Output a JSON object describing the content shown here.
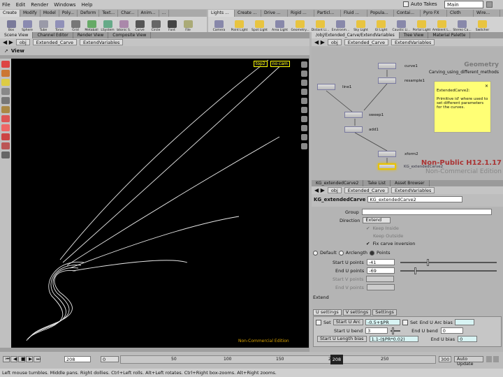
{
  "menubar": {
    "items": [
      "File",
      "Edit",
      "Render",
      "Windows",
      "Help"
    ],
    "autotakes_label": "Auto Takes",
    "take_value": "Main"
  },
  "shelf": {
    "tabs_left": [
      "Create",
      "Modify",
      "Model",
      "Poly...",
      "Deform",
      "Text...",
      "Char...",
      "Anim...",
      "..."
    ],
    "tabs_right": [
      "Lights ...",
      "Create ...",
      "Drive ...",
      "Rigid ...",
      "Particl...",
      "Fluid ...",
      "Popula...",
      "Contai...",
      "Pyro FX",
      "Cloth",
      "Wire..."
    ],
    "tools_left": [
      "Box",
      "Sphere",
      "Tube",
      "Torus",
      "Grid",
      "Metaball",
      "LSystem",
      "Platonic S...",
      "Curve",
      "Circle",
      "Font",
      "File"
    ],
    "tools_right": [
      "Camera",
      "Point Light",
      "Spot Light",
      "Area Light",
      "Geometry...",
      "Distant Li...",
      "Environm...",
      "Sky Light",
      "GI Light",
      "Caustic Li...",
      "Portal Light",
      "Ambient L...",
      "Stereo Ca...",
      "Switcher"
    ]
  },
  "left_pane": {
    "tabs": [
      "Scene View",
      "Channel Editor",
      "Render View",
      "Composite View"
    ],
    "path_obj": "obj",
    "path_node": "Extended_Carve",
    "path_sub": "ExtendVariables",
    "view_title": "View",
    "cam_top": "top2",
    "cam_nocam": "no cam",
    "watermark": "Non-Commercial Edition"
  },
  "network": {
    "tabs": [
      "/obj/Extended_Carve/ExtendVariables",
      "Tree View",
      "Material Palette"
    ],
    "path_obj": "obj",
    "path_node": "Extended_Carve",
    "path_sub": "ExtendVariables",
    "geometry_label": "Geometry",
    "context_label": "Carving_using_different_methods",
    "nodes": [
      "curve1",
      "resample1",
      "line1",
      "sweep1",
      "add1",
      "xform2",
      "KG_extendedCarve2"
    ],
    "note_title": "ExtendedCarve2:",
    "note_body": "Primitive id' where used to set different parameters for the curves.",
    "version": "Non-Public H12.1.17",
    "edition": "Non-Commercial Edition",
    "bottom_tabs": [
      "Take List",
      "Asset Browser"
    ]
  },
  "params": {
    "path_tab": "KG_extendedCarve2",
    "path_obj": "obj",
    "path_node": "Extended_Carve",
    "path_sub": "ExtendVariables",
    "node_type": "KG_extendedCarve",
    "node_name": "KG_extendedCarve2",
    "group_label": "Group",
    "group_value": "",
    "direction_label": "Direction",
    "direction_value": "Extend",
    "keep_inside": "Keep Inside",
    "keep_outside": "Keep Outside",
    "fix_carve": "Fix carve inversion",
    "modes": [
      "Default",
      "Arclength",
      "Points"
    ],
    "start_u_label": "Start U points",
    "start_u_value": "-41",
    "end_u_label": "End U points",
    "end_u_value": "-69",
    "start_v_label": "Start V points",
    "end_v_label": "End V points",
    "extend_label": "Extend",
    "tabs": [
      "U settings",
      "V settings",
      "Settings"
    ],
    "set_label": "Set",
    "start_u_arc_btn": "Start U Arc",
    "start_u_arc_value": "-0.5+$PR",
    "set2_label": "Set",
    "end_u_arc_bias": "End U Arc bias",
    "start_u_bend_label": "Start U bend",
    "start_u_bend_value": "3",
    "end_u_bend_label": "End U bend",
    "end_u_bend_value": "0",
    "start_u_len_btn": "Start U Length bias",
    "start_u_len_value": "1.1-($PR*0.02)",
    "end_u_len_label": "End U bias",
    "end_u_len_value": "0"
  },
  "timeline": {
    "frame": "208",
    "start": "0",
    "cursor": "208",
    "end": "300",
    "ticks": [
      "50",
      "100",
      "150",
      "200",
      "250",
      "300"
    ],
    "autoupdate": "Auto Update"
  },
  "status": "Left mouse tumbles. Middle pans. Right dollies. Ctrl+Left rolls. Alt+Left rotates. Ctrl+Right box-zooms. Alt+Right zooms."
}
